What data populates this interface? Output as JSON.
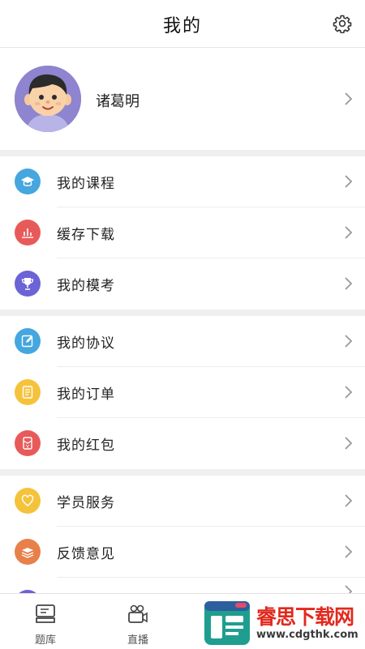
{
  "header": {
    "title": "我的",
    "settings_icon": "gear-icon"
  },
  "profile": {
    "name": "诸葛明"
  },
  "groups": [
    [
      {
        "label": "我的课程",
        "icon": "graduation-cap-icon",
        "color": "#45a6e0"
      },
      {
        "label": "缓存下载",
        "icon": "bar-chart-icon",
        "color": "#e85a5a"
      },
      {
        "label": "我的模考",
        "icon": "trophy-icon",
        "color": "#6c63d6"
      }
    ],
    [
      {
        "label": "我的协议",
        "icon": "edit-document-icon",
        "color": "#45a6e0"
      },
      {
        "label": "我的订单",
        "icon": "order-list-icon",
        "color": "#f5c33b"
      },
      {
        "label": "我的红包",
        "icon": "red-packet-icon",
        "color": "#e85a5a"
      }
    ],
    [
      {
        "label": "学员服务",
        "icon": "heart-icon",
        "color": "#f5c33b"
      },
      {
        "label": "反馈意见",
        "icon": "feedback-stack-icon",
        "color": "#e8804a"
      }
    ]
  ],
  "tabbar": [
    {
      "label": "题库",
      "icon": "question-bank-icon"
    },
    {
      "label": "直播",
      "icon": "live-camera-icon"
    }
  ],
  "watermark": {
    "text": "睿思下载网",
    "url": "www.cdgthk.com"
  },
  "colors": {
    "separator": "#efefef",
    "text": "#222222",
    "chevron": "#999999"
  }
}
